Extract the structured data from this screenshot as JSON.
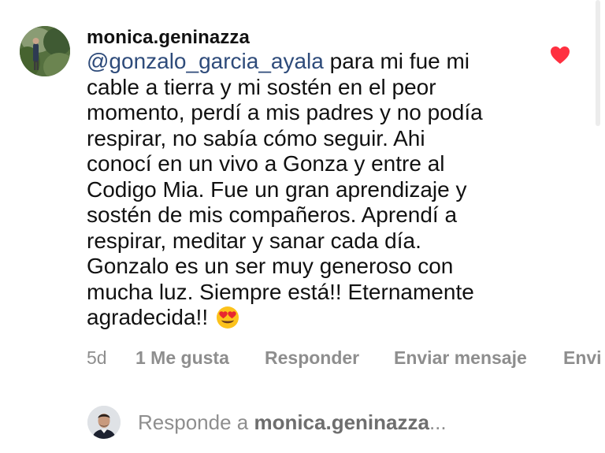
{
  "comment": {
    "username": "monica.geninazza",
    "mention": "@gonzalo_garcia_ayala",
    "text": " para mi fue mi\ncable a tierra y mi sostén en el peor\nmomento, perdí a mis padres y no podía\nrespirar, no sabía cómo seguir. Ahi\nconocí en un vivo a Gonza y entre al\nCodigo Mia. Fue un gran aprendizaje y\nsostén de mis compañeros. Aprendí a\nrespirar, meditar y sanar cada día.\nGonzalo es un ser muy generoso con\nmucha luz. Siempre está!! Eternamente\nagradecida!!",
    "emoji": "smiling-face-with-heart-eyes",
    "liked": true,
    "heart_color": "#ff3040",
    "mention_color": "#2e4b7a"
  },
  "actions": {
    "age": "5d",
    "likes": "1 Me gusta",
    "reply": "Responder",
    "send_message": "Enviar mensaje",
    "more": "Envi"
  },
  "reply_box": {
    "prefix": "Responde a ",
    "username": "monica.geninazza",
    "suffix": "..."
  }
}
